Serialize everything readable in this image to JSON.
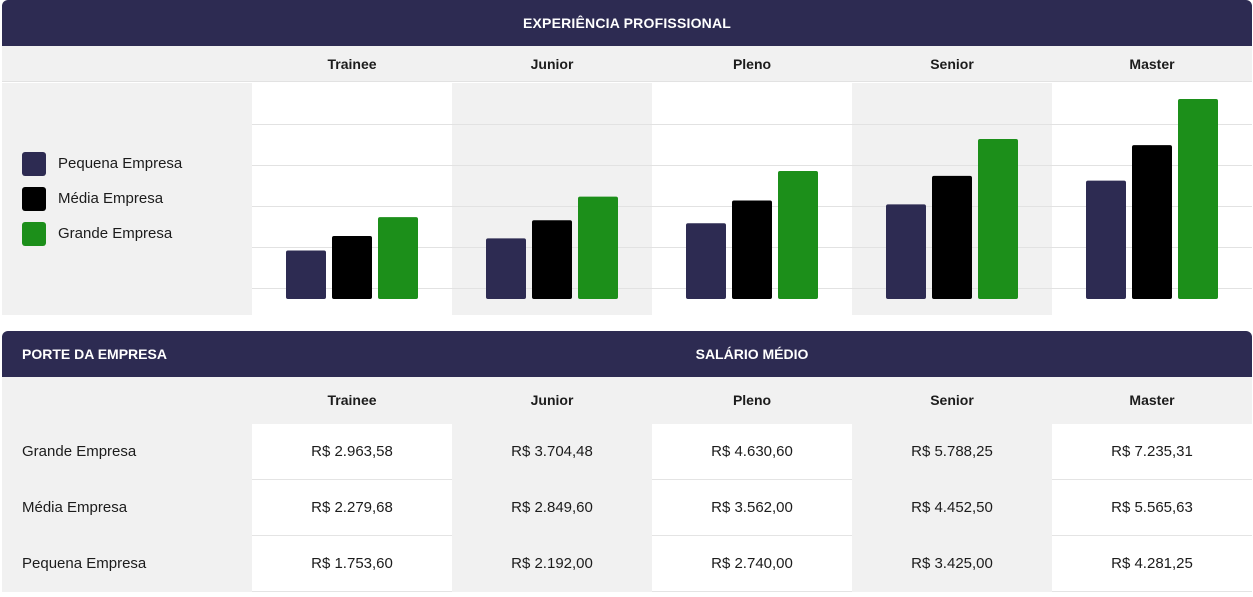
{
  "chart_section": {
    "title": "EXPERIÊNCIA PROFISSIONAL"
  },
  "legend": [
    {
      "label": "Pequena Empresa",
      "color": "#2d2b52"
    },
    {
      "label": "Média Empresa",
      "color": "#000000"
    },
    {
      "label": "Grande Empresa",
      "color": "#1c8f1a"
    }
  ],
  "chart_data": {
    "type": "bar",
    "title": "EXPERIÊNCIA PROFISSIONAL",
    "categories": [
      "Trainee",
      "Junior",
      "Pleno",
      "Senior",
      "Master"
    ],
    "series": [
      {
        "name": "Pequena Empresa",
        "color": "#2d2b52",
        "values": [
          1753.6,
          2192.0,
          2740.0,
          3425.0,
          4281.25
        ]
      },
      {
        "name": "Média Empresa",
        "color": "#000000",
        "values": [
          2279.68,
          2849.6,
          3562.0,
          4452.5,
          5565.63
        ]
      },
      {
        "name": "Grande Empresa",
        "color": "#1c8f1a",
        "values": [
          2963.58,
          3704.48,
          4630.6,
          5788.25,
          7235.31
        ]
      }
    ],
    "ylim": [
      0,
      8000
    ],
    "grid": true,
    "legend_position": "left"
  },
  "table": {
    "header_left": "PORTE DA EMPRESA",
    "header_title": "SALÁRIO MÉDIO",
    "columns": [
      "Trainee",
      "Junior",
      "Pleno",
      "Senior",
      "Master"
    ],
    "rows": [
      {
        "label": "Grande Empresa",
        "values": [
          "R$ 2.963,58",
          "R$ 3.704,48",
          "R$ 4.630,60",
          "R$ 5.788,25",
          "R$ 7.235,31"
        ]
      },
      {
        "label": "Média Empresa",
        "values": [
          "R$ 2.279,68",
          "R$ 2.849,60",
          "R$ 3.562,00",
          "R$ 4.452,50",
          "R$ 5.565,63"
        ]
      },
      {
        "label": "Pequena Empresa",
        "values": [
          "R$ 1.753,60",
          "R$ 2.192,00",
          "R$ 2.740,00",
          "R$ 3.425,00",
          "R$ 4.281,25"
        ]
      }
    ]
  }
}
